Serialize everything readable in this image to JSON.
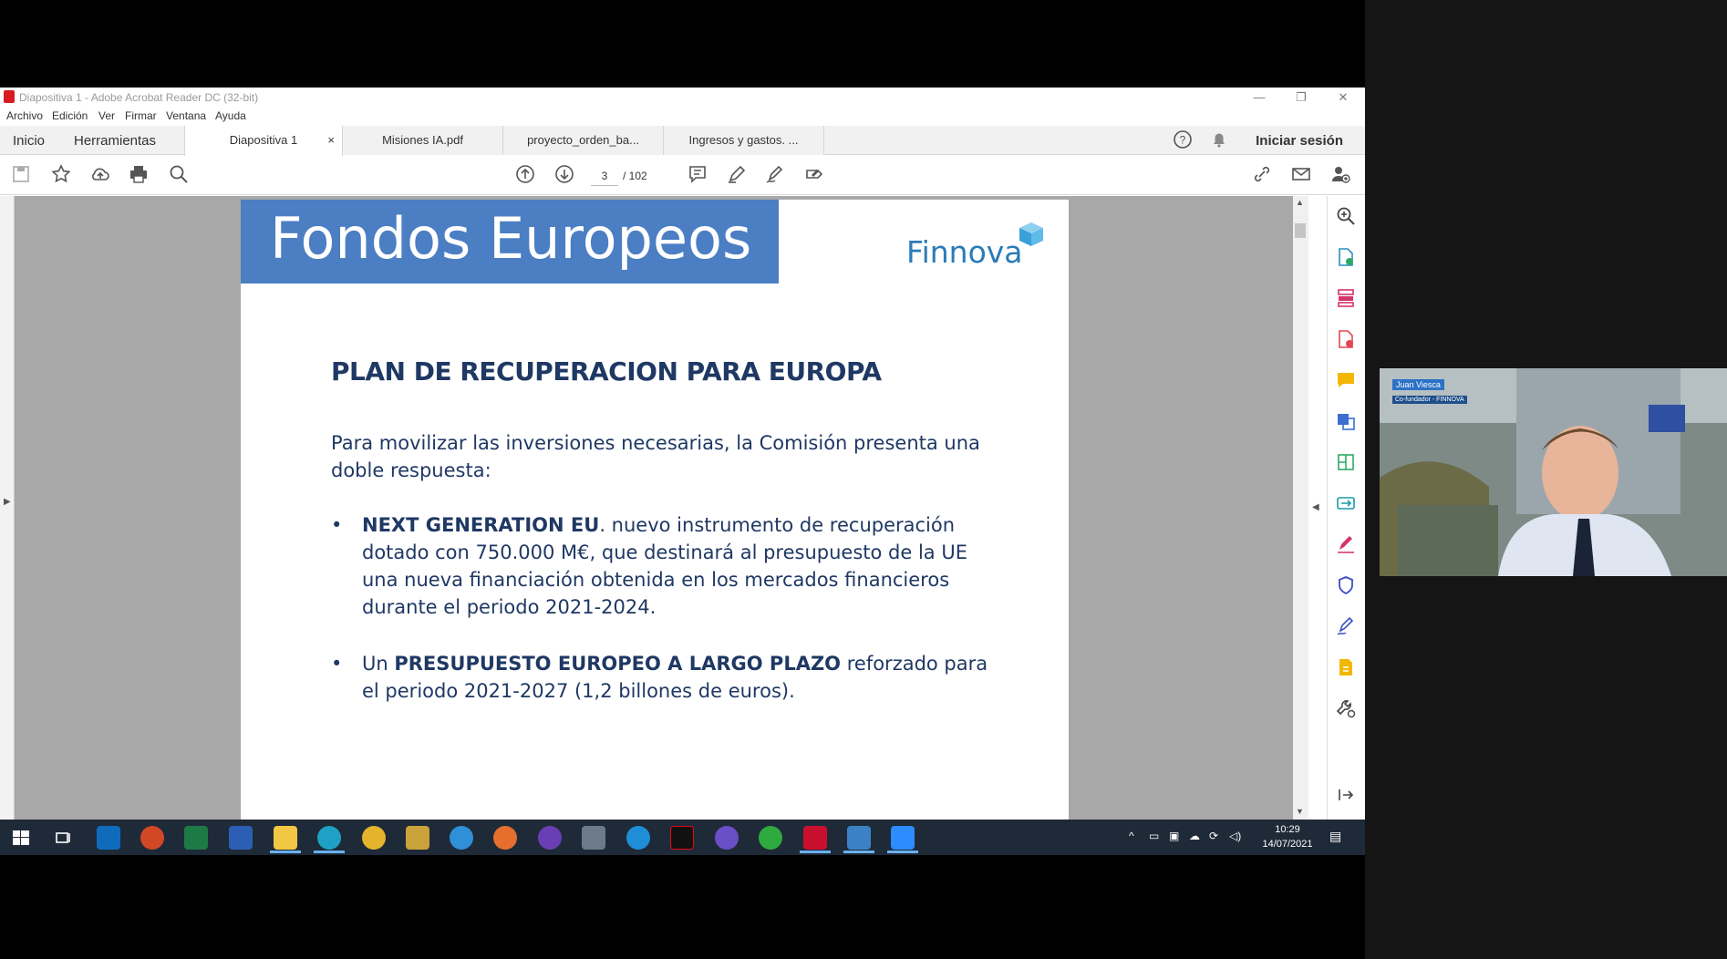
{
  "window": {
    "title": "Diapositiva 1 - Adobe Acrobat Reader DC (32-bit)",
    "minimize": "—",
    "restore": "❐",
    "close": "✕"
  },
  "menu": [
    "Archivo",
    "Edición",
    "Ver",
    "Firmar",
    "Ventana",
    "Ayuda"
  ],
  "nav": {
    "home": "Inicio",
    "tools": "Herramientas",
    "signin": "Iniciar sesión"
  },
  "tabs": [
    {
      "label": "Diapositiva 1",
      "close": "×"
    },
    {
      "label": "Misiones IA.pdf"
    },
    {
      "label": "proyecto_orden_ba..."
    },
    {
      "label": "Ingresos y gastos. ..."
    }
  ],
  "page_nav": {
    "current": "3",
    "total": "/  102"
  },
  "slide": {
    "header": "Fondos Europeos",
    "logo": "Finnova",
    "title": "PLAN DE RECUPERACION PARA EUROPA",
    "intro": "Para movilizar las inversiones necesarias, la Comisión presenta una doble respuesta:",
    "bullet1_bold": "NEXT GENERATION EU",
    "bullet1_rest": ". nuevo instrumento de recuperación dotado con 750.000 M€, que destinará al presupuesto de la UE una nueva financiación obtenida en los mercados financieros durante el periodo 2021-2024.",
    "bullet2_pre": "Un ",
    "bullet2_bold": "PRESUPUESTO EUROPEO A LARGO PLAZO",
    "bullet2_rest": " reforzado para el periodo 2021-2027 (1,2 billones de euros).",
    "bullet_char": "•"
  },
  "taskbar": {
    "time": "10:29",
    "date": "14/07/2021"
  },
  "webcam": {
    "name": "Juan Viesca",
    "subtitle": "Co-fundador - FINNOVA"
  },
  "colors": {
    "slide_header": "#4b7ec3",
    "slide_text": "#1f3864",
    "taskbar": "#1f2a38",
    "logo": "#2a7bb8"
  }
}
